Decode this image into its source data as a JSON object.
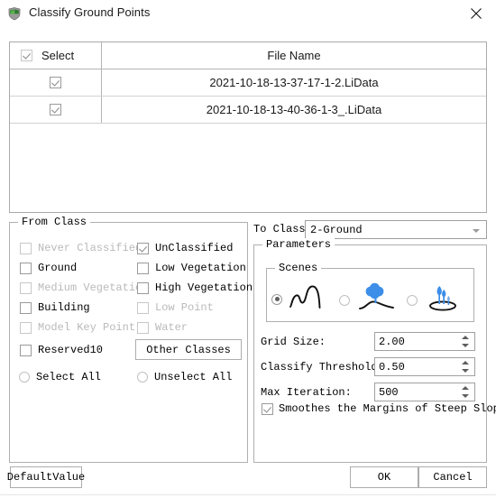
{
  "window": {
    "title": "Classify Ground Points",
    "icon": "app-shield-icon",
    "close_icon": "close-icon"
  },
  "file_table": {
    "columns": [
      "Select",
      "File Name"
    ],
    "header_checkbox_checked": true,
    "rows": [
      {
        "selected": true,
        "file_name": "2021-10-18-13-37-17-1-2.LiData"
      },
      {
        "selected": true,
        "file_name": "2021-10-18-13-40-36-1-3_.LiData"
      }
    ]
  },
  "from_class": {
    "title": "From Class",
    "items": [
      {
        "label": "Never Classified",
        "checked": false,
        "disabled": true
      },
      {
        "label": "UnClassified",
        "checked": true,
        "disabled": false
      },
      {
        "label": "Ground",
        "checked": false,
        "disabled": false
      },
      {
        "label": "Low Vegetation",
        "checked": false,
        "disabled": false
      },
      {
        "label": "Medium Vegetation",
        "checked": false,
        "disabled": true
      },
      {
        "label": "High Vegetation",
        "checked": false,
        "disabled": false
      },
      {
        "label": "Building",
        "checked": false,
        "disabled": false
      },
      {
        "label": "Low Point",
        "checked": false,
        "disabled": true
      },
      {
        "label": "Model Key Point",
        "checked": false,
        "disabled": true
      },
      {
        "label": "Water",
        "checked": false,
        "disabled": true
      },
      {
        "label": "Reserved10",
        "checked": false,
        "disabled": false
      }
    ],
    "other_classes_label": "Other Classes",
    "select_all_label": "Select All",
    "unselect_all_label": "Unselect All",
    "select_all_selected": false,
    "unselect_all_selected": false
  },
  "to_class": {
    "label": "To Class:",
    "value": "2-Ground",
    "options": [
      "2-Ground"
    ]
  },
  "parameters": {
    "title": "Parameters",
    "scenes": {
      "title": "Scenes",
      "options": [
        {
          "icon": "terrain-hills-icon",
          "selected": true
        },
        {
          "icon": "tree-on-slope-icon",
          "selected": false
        },
        {
          "icon": "shrubs-on-flat-ground-icon",
          "selected": false
        }
      ],
      "accent_color": "#3c8ee8"
    },
    "grid_size": {
      "label": "Grid Size:",
      "value": "2.00"
    },
    "classify_threshold": {
      "label": "Classify Threshold:",
      "value": "0.50"
    },
    "max_iteration": {
      "label": "Max Iteration:",
      "value": "500"
    },
    "smooth_margins": {
      "label": "Smoothes the Margins of Steep Slopes",
      "checked": true
    }
  },
  "footer": {
    "default_value_label": "DefaultValue",
    "ok_label": "OK",
    "cancel_label": "Cancel"
  }
}
